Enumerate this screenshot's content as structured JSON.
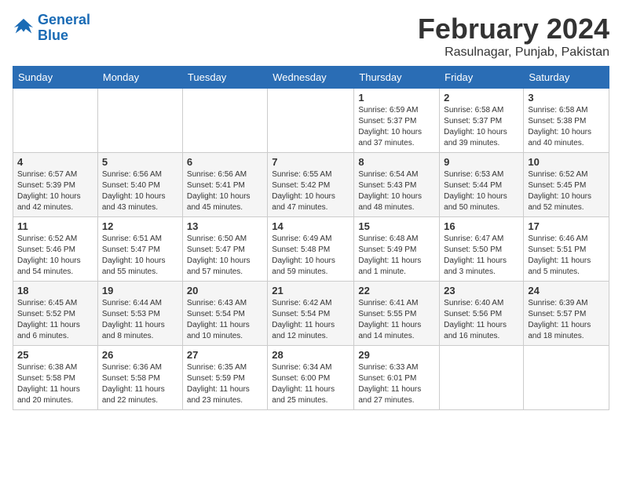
{
  "header": {
    "logo_line1": "General",
    "logo_line2": "Blue",
    "month": "February 2024",
    "location": "Rasulnagar, Punjab, Pakistan"
  },
  "weekdays": [
    "Sunday",
    "Monday",
    "Tuesday",
    "Wednesday",
    "Thursday",
    "Friday",
    "Saturday"
  ],
  "weeks": [
    [
      {
        "day": "",
        "info": ""
      },
      {
        "day": "",
        "info": ""
      },
      {
        "day": "",
        "info": ""
      },
      {
        "day": "",
        "info": ""
      },
      {
        "day": "1",
        "info": "Sunrise: 6:59 AM\nSunset: 5:37 PM\nDaylight: 10 hours\nand 37 minutes."
      },
      {
        "day": "2",
        "info": "Sunrise: 6:58 AM\nSunset: 5:37 PM\nDaylight: 10 hours\nand 39 minutes."
      },
      {
        "day": "3",
        "info": "Sunrise: 6:58 AM\nSunset: 5:38 PM\nDaylight: 10 hours\nand 40 minutes."
      }
    ],
    [
      {
        "day": "4",
        "info": "Sunrise: 6:57 AM\nSunset: 5:39 PM\nDaylight: 10 hours\nand 42 minutes."
      },
      {
        "day": "5",
        "info": "Sunrise: 6:56 AM\nSunset: 5:40 PM\nDaylight: 10 hours\nand 43 minutes."
      },
      {
        "day": "6",
        "info": "Sunrise: 6:56 AM\nSunset: 5:41 PM\nDaylight: 10 hours\nand 45 minutes."
      },
      {
        "day": "7",
        "info": "Sunrise: 6:55 AM\nSunset: 5:42 PM\nDaylight: 10 hours\nand 47 minutes."
      },
      {
        "day": "8",
        "info": "Sunrise: 6:54 AM\nSunset: 5:43 PM\nDaylight: 10 hours\nand 48 minutes."
      },
      {
        "day": "9",
        "info": "Sunrise: 6:53 AM\nSunset: 5:44 PM\nDaylight: 10 hours\nand 50 minutes."
      },
      {
        "day": "10",
        "info": "Sunrise: 6:52 AM\nSunset: 5:45 PM\nDaylight: 10 hours\nand 52 minutes."
      }
    ],
    [
      {
        "day": "11",
        "info": "Sunrise: 6:52 AM\nSunset: 5:46 PM\nDaylight: 10 hours\nand 54 minutes."
      },
      {
        "day": "12",
        "info": "Sunrise: 6:51 AM\nSunset: 5:47 PM\nDaylight: 10 hours\nand 55 minutes."
      },
      {
        "day": "13",
        "info": "Sunrise: 6:50 AM\nSunset: 5:47 PM\nDaylight: 10 hours\nand 57 minutes."
      },
      {
        "day": "14",
        "info": "Sunrise: 6:49 AM\nSunset: 5:48 PM\nDaylight: 10 hours\nand 59 minutes."
      },
      {
        "day": "15",
        "info": "Sunrise: 6:48 AM\nSunset: 5:49 PM\nDaylight: 11 hours\nand 1 minute."
      },
      {
        "day": "16",
        "info": "Sunrise: 6:47 AM\nSunset: 5:50 PM\nDaylight: 11 hours\nand 3 minutes."
      },
      {
        "day": "17",
        "info": "Sunrise: 6:46 AM\nSunset: 5:51 PM\nDaylight: 11 hours\nand 5 minutes."
      }
    ],
    [
      {
        "day": "18",
        "info": "Sunrise: 6:45 AM\nSunset: 5:52 PM\nDaylight: 11 hours\nand 6 minutes."
      },
      {
        "day": "19",
        "info": "Sunrise: 6:44 AM\nSunset: 5:53 PM\nDaylight: 11 hours\nand 8 minutes."
      },
      {
        "day": "20",
        "info": "Sunrise: 6:43 AM\nSunset: 5:54 PM\nDaylight: 11 hours\nand 10 minutes."
      },
      {
        "day": "21",
        "info": "Sunrise: 6:42 AM\nSunset: 5:54 PM\nDaylight: 11 hours\nand 12 minutes."
      },
      {
        "day": "22",
        "info": "Sunrise: 6:41 AM\nSunset: 5:55 PM\nDaylight: 11 hours\nand 14 minutes."
      },
      {
        "day": "23",
        "info": "Sunrise: 6:40 AM\nSunset: 5:56 PM\nDaylight: 11 hours\nand 16 minutes."
      },
      {
        "day": "24",
        "info": "Sunrise: 6:39 AM\nSunset: 5:57 PM\nDaylight: 11 hours\nand 18 minutes."
      }
    ],
    [
      {
        "day": "25",
        "info": "Sunrise: 6:38 AM\nSunset: 5:58 PM\nDaylight: 11 hours\nand 20 minutes."
      },
      {
        "day": "26",
        "info": "Sunrise: 6:36 AM\nSunset: 5:58 PM\nDaylight: 11 hours\nand 22 minutes."
      },
      {
        "day": "27",
        "info": "Sunrise: 6:35 AM\nSunset: 5:59 PM\nDaylight: 11 hours\nand 23 minutes."
      },
      {
        "day": "28",
        "info": "Sunrise: 6:34 AM\nSunset: 6:00 PM\nDaylight: 11 hours\nand 25 minutes."
      },
      {
        "day": "29",
        "info": "Sunrise: 6:33 AM\nSunset: 6:01 PM\nDaylight: 11 hours\nand 27 minutes."
      },
      {
        "day": "",
        "info": ""
      },
      {
        "day": "",
        "info": ""
      }
    ]
  ]
}
